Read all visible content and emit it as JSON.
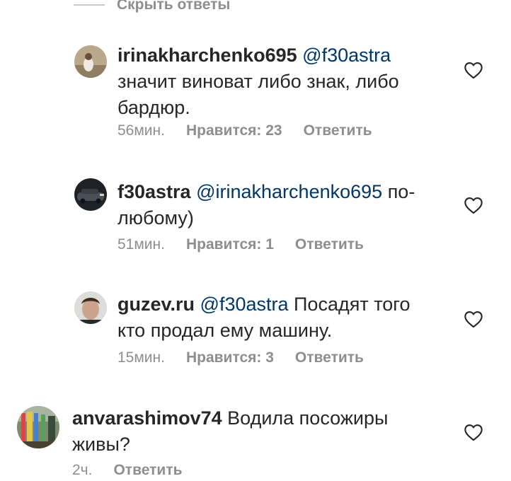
{
  "hide_replies_label": "Скрыть ответы",
  "comments": [
    {
      "username": "irinakharchenko695",
      "mention": "@f30astra",
      "text": "значит виноват либо знак, либо бардюр.",
      "time": "56мин.",
      "likes": "Нравится: 23",
      "reply": "Ответить"
    },
    {
      "username": "f30astra",
      "mention": "@irinakharchenko695",
      "text": "по-любому)",
      "time": "51мин.",
      "likes": "Нравится: 1",
      "reply": "Ответить"
    },
    {
      "username": "guzev.ru",
      "mention": "@f30astra",
      "text": "Посадят того кто продал ему машину.",
      "time": "15мин.",
      "likes": "Нравится: 3",
      "reply": "Ответить"
    },
    {
      "username": "anvarashimov74",
      "mention": "",
      "text": "Водила посожиры живы?",
      "time": "2ч.",
      "likes": "",
      "reply": "Ответить"
    }
  ],
  "colors": {
    "text": "#262626",
    "muted": "#8e8e8e",
    "mention": "#00376b",
    "divider": "#c7c7c7"
  },
  "icons": [
    "heart-outline-icon"
  ]
}
